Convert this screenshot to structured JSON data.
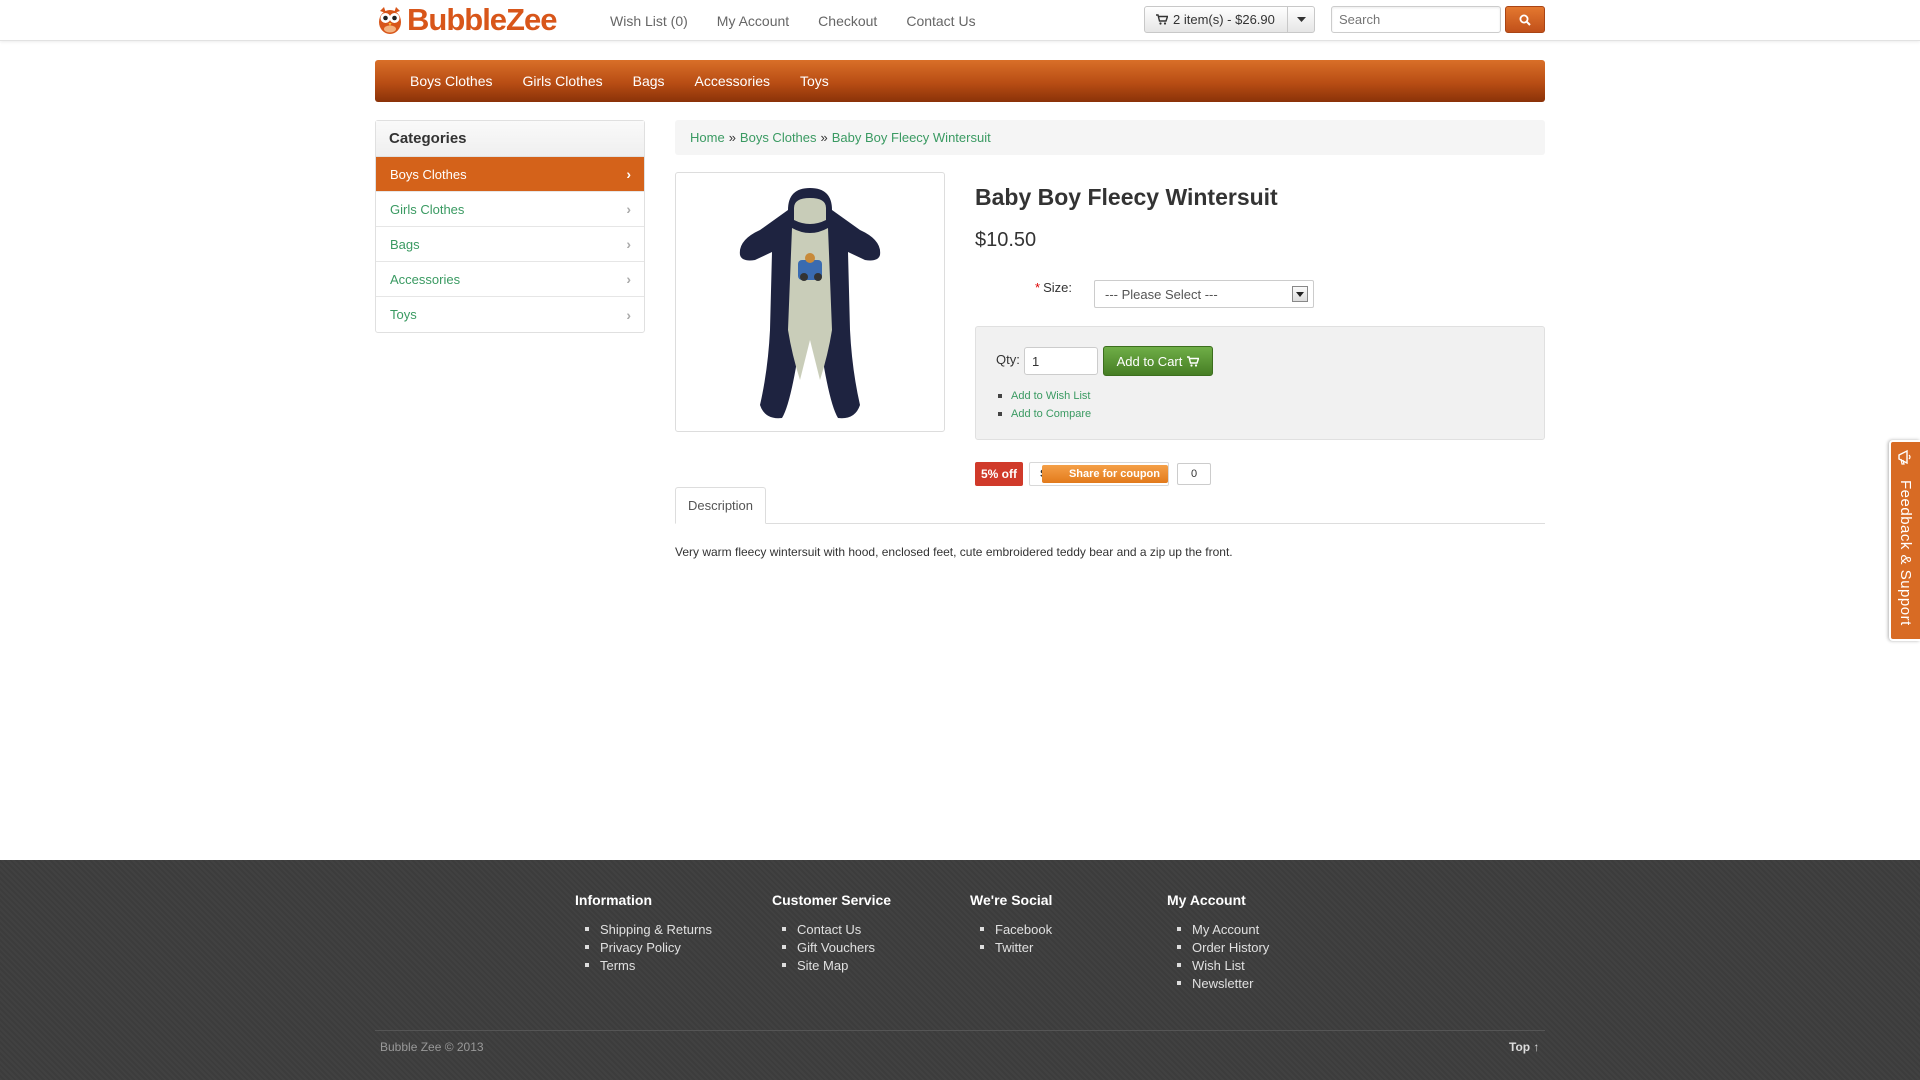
{
  "brand": {
    "name": "BubbleZee",
    "accent": "#d4621a"
  },
  "top_nav": {
    "items": [
      "Wish List (0)",
      "My Account",
      "Checkout",
      "Contact Us"
    ]
  },
  "cart": {
    "summary": "2 item(s) - $26.90",
    "icon": "cart-icon"
  },
  "search": {
    "placeholder": "Search",
    "icon": "search-icon"
  },
  "main_menu": {
    "items": [
      "Boys Clothes",
      "Girls Clothes",
      "Bags",
      "Accessories",
      "Toys"
    ]
  },
  "sidebar": {
    "title": "Categories",
    "items": [
      {
        "label": "Boys Clothes",
        "active": true
      },
      {
        "label": "Girls Clothes",
        "active": false
      },
      {
        "label": "Bags",
        "active": false
      },
      {
        "label": "Accessories",
        "active": false
      },
      {
        "label": "Toys",
        "active": false
      }
    ]
  },
  "breadcrumb": {
    "items": [
      "Home",
      "Boys Clothes",
      "Baby Boy Fleecy Wintersuit"
    ],
    "separator": "»"
  },
  "product": {
    "title": "Baby Boy Fleecy Wintersuit",
    "price": "$10.50",
    "size_label": "Size:",
    "size_required": "*",
    "size_selected": "--- Please Select ---",
    "qty_label": "Qty:",
    "qty_value": "1",
    "add_to_cart": "Add to Cart",
    "links": [
      "Add to Wish List",
      "Add to Compare"
    ],
    "description": "Very warm fleecy wintersuit with hood, enclosed feet, cute embroidered teddy bear and a zip up the front."
  },
  "coupon": {
    "discount": "5% off",
    "share_prefix": "Sł",
    "share_label": "Share for coupon",
    "count": "0"
  },
  "tabs": [
    "Description"
  ],
  "feedback": {
    "label": "Feedback & Support"
  },
  "footer": {
    "columns": [
      {
        "title": "Information",
        "items": [
          "Shipping & Returns",
          "Privacy Policy",
          "Terms"
        ]
      },
      {
        "title": "Customer Service",
        "items": [
          "Contact Us",
          "Gift Vouchers",
          "Site Map"
        ]
      },
      {
        "title": "We're Social",
        "items": [
          "Facebook",
          "Twitter"
        ]
      },
      {
        "title": "My Account",
        "items": [
          "My Account",
          "Order History",
          "Wish List",
          "Newsletter"
        ]
      }
    ],
    "copyright": "Bubble Zee © 2013",
    "top_link": "Top ↑"
  }
}
